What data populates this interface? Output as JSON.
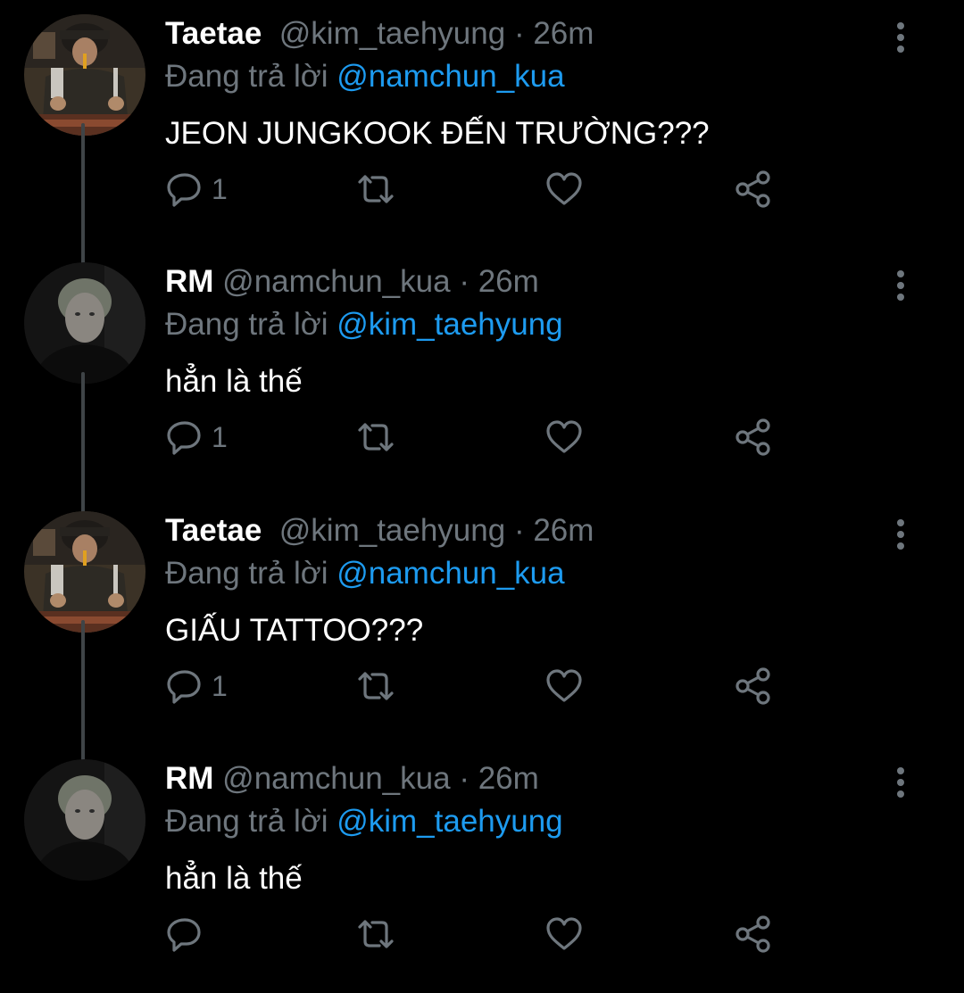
{
  "reply_prefix": "Đang trả lời",
  "dot": "·",
  "colors": {
    "background": "#000000",
    "text": "#ffffff",
    "secondary": "#6e767d",
    "mention": "#1d9bf0",
    "thread_line": "#3f4447"
  },
  "icons": [
    "reply-icon",
    "retweet-icon",
    "like-icon",
    "share-icon",
    "more-vertical-icon"
  ],
  "tweets": [
    {
      "name": "Taetae",
      "handle": "@kim_taehyung",
      "time": "26m",
      "reply_to": "@namchun_kua",
      "text": "JEON JUNGKOOK ĐẾN TRƯỜNG???",
      "reply_count": "1",
      "avatar": "taetae"
    },
    {
      "name": "RM",
      "handle": "@namchun_kua",
      "time": "26m",
      "reply_to": "@kim_taehyung",
      "text": "hẳn là thế",
      "reply_count": "1",
      "avatar": "rm"
    },
    {
      "name": "Taetae",
      "handle": "@kim_taehyung",
      "time": "26m",
      "reply_to": "@namchun_kua",
      "text": "GIẤU TATTOO???",
      "reply_count": "1",
      "avatar": "taetae"
    },
    {
      "name": "RM",
      "handle": "@namchun_kua",
      "time": "26m",
      "reply_to": "@kim_taehyung",
      "text": "hẳn là thế",
      "reply_count": "",
      "avatar": "rm"
    }
  ]
}
